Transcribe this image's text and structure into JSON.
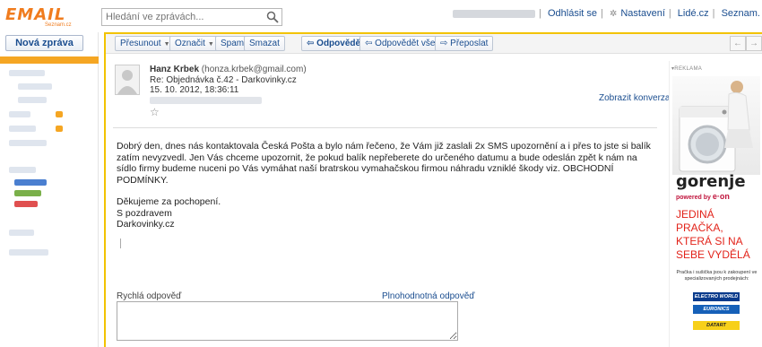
{
  "header": {
    "logo_text": "EMAIL",
    "logo_sub": "Seznam.cz",
    "search_placeholder": "Hledání ve zprávách...",
    "links": [
      "Odhlásit se",
      "Nastavení",
      "Lidé.cz",
      "Seznam."
    ]
  },
  "sidebar": {
    "new_mail": "Nová zpráva"
  },
  "toolbar": {
    "move": "Přesunout",
    "mark": "Označit",
    "spam": "Spam",
    "delete": "Smazat",
    "reply": "Odpovědět",
    "reply_all": "Odpovědět všem",
    "forward": "Přeposlat"
  },
  "message": {
    "sender_name": "Hanz Krbek",
    "sender_email": "(honza.krbek@gmail.com)",
    "subject": "Re: Objednávka č.42 - Darkovinky.cz",
    "date": "15. 10. 2012, 18:36:11",
    "show_conversation": "Zobrazit konverzaci",
    "body": [
      "Dobrý den, dnes nás kontaktovala Česká Pošta a bylo nám řečeno, že Vám již zaslali 2x SMS upozornění a i přes to jste si balík zatím nevyzvedl. Jen Vás chceme upozornit, že pokud balík nepřeberete do určeného datumu a bude odeslán zpět k nám na sídlo firmy budeme nuceni po Vás vymáhat naší bratrskou vymahačskou firmou náhradu vzniklé škody viz. OBCHODNÍ PODMÍNKY.",
      "Děkujeme za pochopení.",
      "S pozdravem",
      "Darkovinky.cz"
    ]
  },
  "quick_reply": {
    "label": "Rychlá odpověď",
    "full_link": "Plnohodnotná odpověď"
  },
  "ad": {
    "label": "▾REKLAMA",
    "brand": "gorenje",
    "brand_sub_prefix": "powered by ",
    "brand_sub_name": "e·on",
    "slogan": "JEDINÁ PRAČKA, KTERÁ SI NA SEBE VYDĚLÁ",
    "small_text": "Pračka i sušička jsou k zakoupení ve specializovaných prodejnách:",
    "retailers": [
      "ELECTRO WORLD",
      "EURONICS",
      "DATART"
    ]
  },
  "colors": {
    "accent_orange": "#f5a623",
    "main_border_yellow": "#f2c300",
    "link_blue": "#1a4d8f",
    "slogan_red": "#e2231a"
  }
}
